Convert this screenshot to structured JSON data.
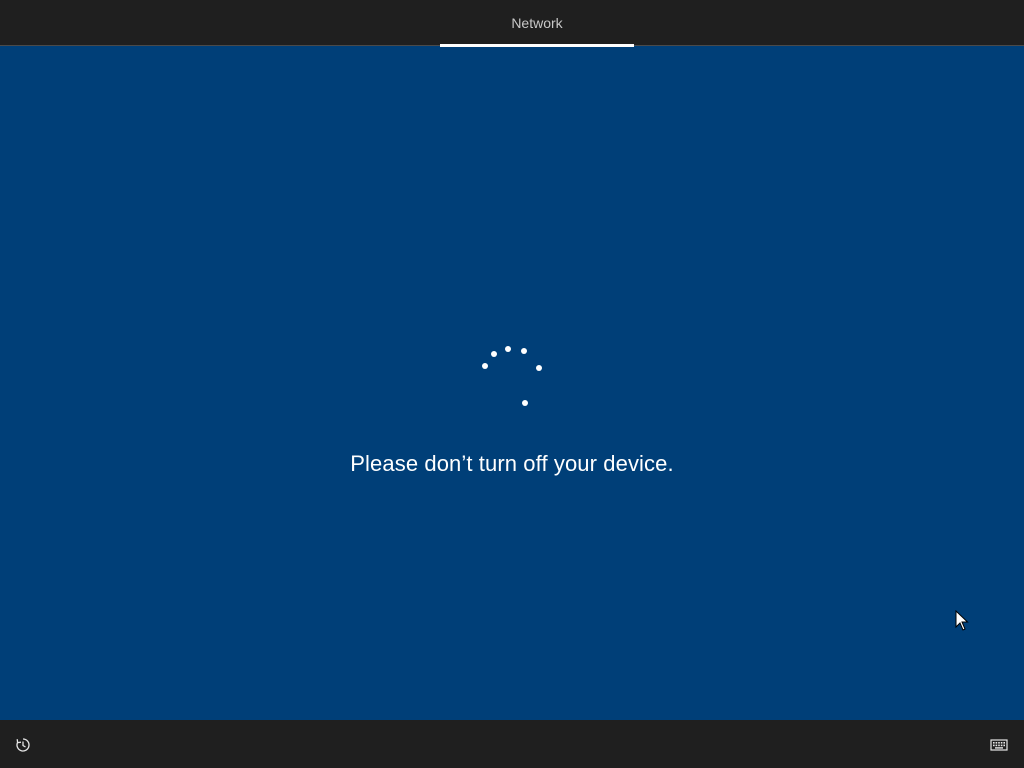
{
  "top_bar": {
    "tab_label": "Network"
  },
  "main": {
    "message": "Please don’t turn off your device."
  },
  "icons": {
    "spinner": "loading-spinner-icon",
    "ease_of_access": "ease-of-access-icon",
    "keyboard": "keyboard-icon",
    "cursor": "mouse-pointer-icon"
  },
  "colors": {
    "background": "#003f78",
    "bars": "#1f1f1f",
    "accent": "#ffffff"
  }
}
